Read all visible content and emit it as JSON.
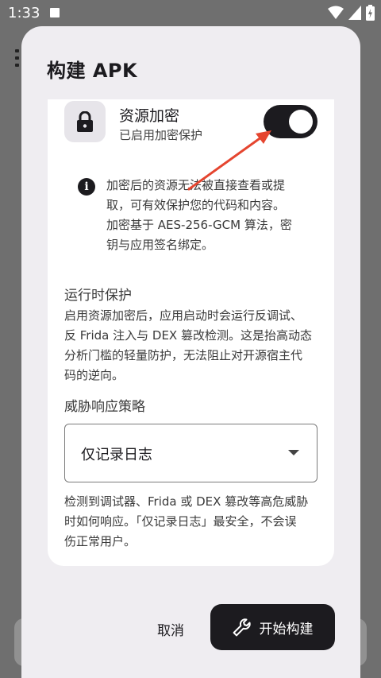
{
  "status_bar": {
    "time": "1:33"
  },
  "dialog": {
    "title": "构建 APK",
    "resource_encryption": {
      "title": "资源加密",
      "subtitle": "已启用加密保护",
      "enabled": true
    },
    "info_lines": [
      "加密后的资源无法被直接查看或提",
      "取，可有效保护您的代码和内容。",
      "加密基于 AES-256-GCM 算法，密",
      "钥与应用签名绑定。"
    ],
    "runtime": {
      "title": "运行时保护",
      "desc_lines": [
        "启用资源加密后，应用启动时会运行反调试、",
        "反 Frida 注入与 DEX 篡改检测。这是抬高动态",
        "分析门槛的轻量防护，无法阻止对开源宿主代",
        "码的逆向。"
      ]
    },
    "policy": {
      "label": "威胁响应策略",
      "selected": "仅记录日志",
      "help_lines": [
        "检测到调试器、Frida 或 DEX 篡改等高危威胁",
        "时如何响应。「仅记录日志」最安全，不会误",
        "伤正常用户。"
      ]
    },
    "cancel_label": "取消",
    "build_label": "开始构建"
  },
  "colors": {
    "scrim": "#6f6f6f",
    "dialog_bg": "#efedf1",
    "card_bg": "#ffffff",
    "primary_dark": "#1c1b1f",
    "annotation_arrow": "#e5452f"
  },
  "icons": {
    "lock": "lock-icon",
    "info": "info-icon",
    "wrench": "wrench-icon",
    "dropdown": "dropdown-arrow-icon"
  }
}
